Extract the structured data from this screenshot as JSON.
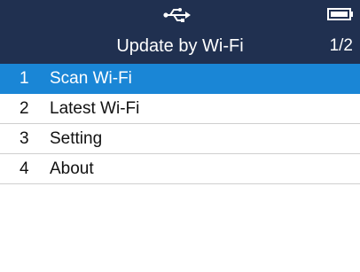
{
  "status_bar": {
    "icons": [
      "usb-icon",
      "battery-icon"
    ]
  },
  "header": {
    "title": "Update by Wi-Fi",
    "page_indicator": "1/2"
  },
  "menu": {
    "items": [
      {
        "number": "1",
        "label": "Scan Wi-Fi",
        "selected": true
      },
      {
        "number": "2",
        "label": "Latest Wi-Fi",
        "selected": false
      },
      {
        "number": "3",
        "label": "Setting",
        "selected": false
      },
      {
        "number": "4",
        "label": "About",
        "selected": false
      }
    ]
  },
  "colors": {
    "header_background": "#203050",
    "selected_row": "#1a86d6",
    "text": "#111111"
  }
}
